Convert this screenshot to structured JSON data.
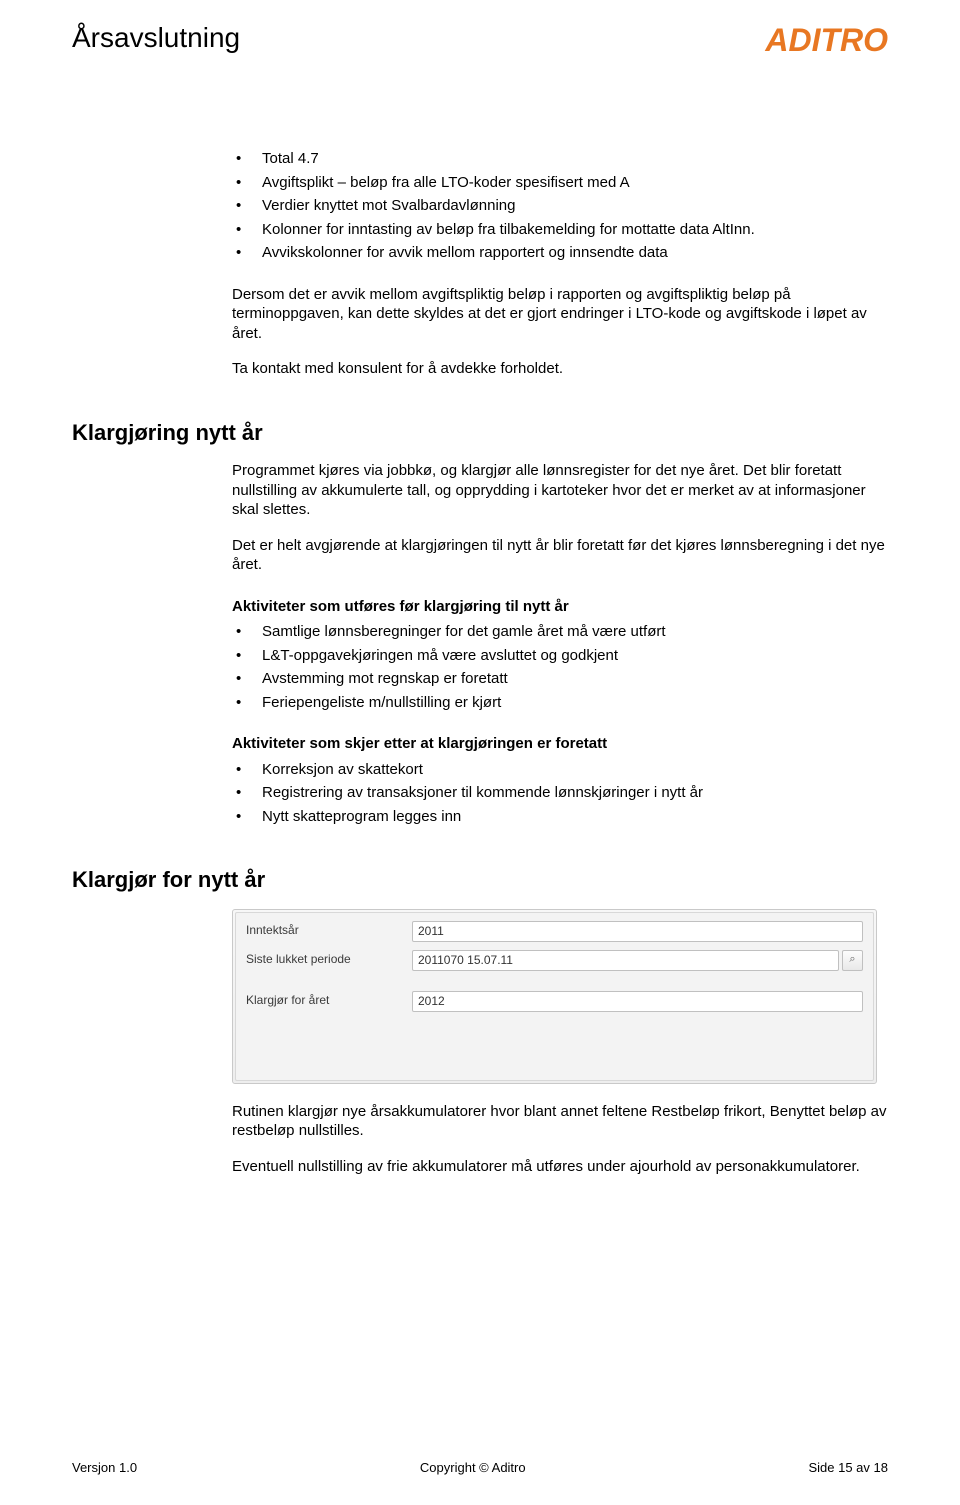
{
  "header": {
    "title": "Årsavslutning",
    "logo": "ADITRO"
  },
  "top_bullets": [
    "Total 4.7",
    "Avgiftsplikt – beløp fra alle LTO-koder spesifisert med A",
    "Verdier knyttet mot Svalbardavlønning",
    "Kolonner for inntasting av beløp fra tilbakemelding for mottatte data AltInn.",
    "Avvikskolonner for avvik mellom rapportert og innsendte data"
  ],
  "para1": "Dersom det er avvik mellom avgiftspliktig beløp i rapporten og avgiftspliktig beløp på terminoppgaven, kan dette skyldes at det er gjort endringer i LTO-kode og avgiftskode i løpet av året.",
  "para2": "Ta kontakt med konsulent for å avdekke forholdet.",
  "sec1": {
    "title": "Klargjøring nytt år",
    "p1": "Programmet kjøres via jobbkø, og klargjør alle lønnsregister for det nye året. Det blir foretatt nullstilling av akkumulerte tall, og opprydding i kartoteker hvor det er merket av at informasjoner skal slettes.",
    "p2": "Det er helt avgjørende at klargjøringen til nytt år blir foretatt før det kjøres lønnsberegning i det nye året.",
    "h_before": "Aktiviteter som utføres før klargjøring til nytt år",
    "before_items": [
      "Samtlige lønnsberegninger for det gamle året må være utført",
      "L&T-oppgavekjøringen må være avsluttet og godkjent",
      "Avstemming mot regnskap er foretatt",
      "Feriepengeliste m/nullstilling er kjørt"
    ],
    "h_after": "Aktiviteter som skjer etter at klargjøringen er foretatt",
    "after_items": [
      "Korreksjon av skattekort",
      "Registrering av transaksjoner til kommende lønnskjøringer i nytt år",
      "Nytt skatteprogram legges inn"
    ]
  },
  "sec2": {
    "title": "Klargjør for nytt år",
    "form": {
      "row1_label": "Inntektsår",
      "row1_value": "2011",
      "row2_label": "Siste lukket periode",
      "row2_value": "2011070 15.07.11",
      "row3_label": "Klargjør for året",
      "row3_value": "2012"
    },
    "p_after1": "Rutinen klargjør nye årsakkumulatorer hvor blant annet feltene Restbeløp frikort, Benyttet beløp av restbeløp nullstilles.",
    "p_after2": "Eventuell nullstilling av frie akkumulatorer må utføres under ajourhold av personakkumulatorer."
  },
  "footer": {
    "left": "Versjon 1.0",
    "center": "Copyright © Aditro",
    "right": "Side 15 av 18"
  }
}
